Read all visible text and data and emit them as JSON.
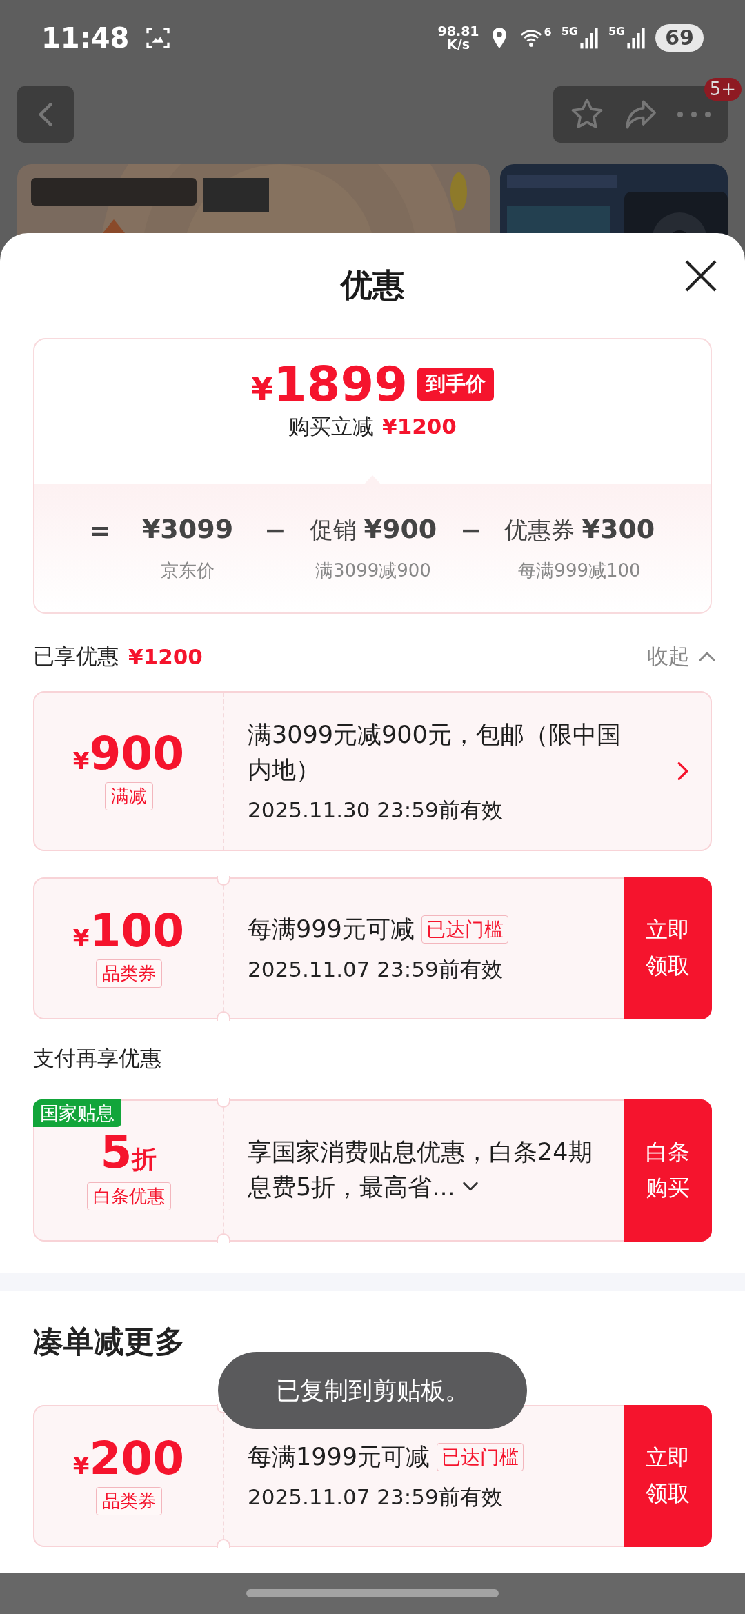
{
  "status_bar": {
    "time": "11:48",
    "net_speed": [
      "98.81",
      "K/s"
    ],
    "wifi_label": "6",
    "signal_labels": [
      "5G",
      "5G"
    ],
    "battery": "69"
  },
  "nav": {
    "badge": "5+"
  },
  "sheet": {
    "title": "优惠"
  },
  "price_card": {
    "price": {
      "currency": "¥",
      "value": "1899"
    },
    "price_tag": "到手价",
    "saving_label": "购买立减",
    "saving": "¥1200",
    "breakdown": [
      {
        "operator": "=",
        "amount": "¥3099",
        "note": "京东价"
      },
      {
        "operator": "−",
        "title": "促销",
        "amount": "¥900",
        "note": "满3099减900"
      },
      {
        "operator": "−",
        "title": "优惠券",
        "amount": "¥300",
        "note": "每满999减100"
      }
    ]
  },
  "applied": {
    "label": "已享优惠",
    "amount": "¥1200",
    "toggle": "收起",
    "expanded": true
  },
  "coupons": [
    {
      "amount": {
        "currency": "¥",
        "value": "900"
      },
      "type_label": "满减",
      "description": "满3099元减900元，包邮（限中国内地）",
      "validity": "2025.11.30 23:59前有效",
      "action": {
        "kind": "arrow"
      }
    },
    {
      "amount": {
        "currency": "¥",
        "value": "100"
      },
      "type_label": "品类券",
      "description": "每满999元可减",
      "threshold_badge": "已达门槛",
      "validity": "2025.11.07 23:59前有效",
      "action": {
        "kind": "button",
        "label": "立即领取"
      }
    }
  ],
  "pay_section": {
    "title": "支付再享优惠",
    "coupons": [
      {
        "corner_tag": "国家贴息",
        "amount": {
          "value": "5",
          "unit": "折"
        },
        "type_label": "白条优惠",
        "description": "享国家消费贴息优惠，白条24期息费5折，最高省...",
        "expandable": true,
        "action": {
          "kind": "button",
          "label": "白条购买"
        }
      }
    ]
  },
  "more_section": {
    "title": "凑单减更多",
    "coupons": [
      {
        "amount": {
          "currency": "¥",
          "value": "200"
        },
        "type_label": "品类券",
        "description": "每满1999元可减",
        "threshold_badge": "已达门槛",
        "validity": "2025.11.07 23:59前有效",
        "action": {
          "kind": "button",
          "label": "立即领取"
        }
      }
    ]
  },
  "toast": "已复制到剪贴板。"
}
